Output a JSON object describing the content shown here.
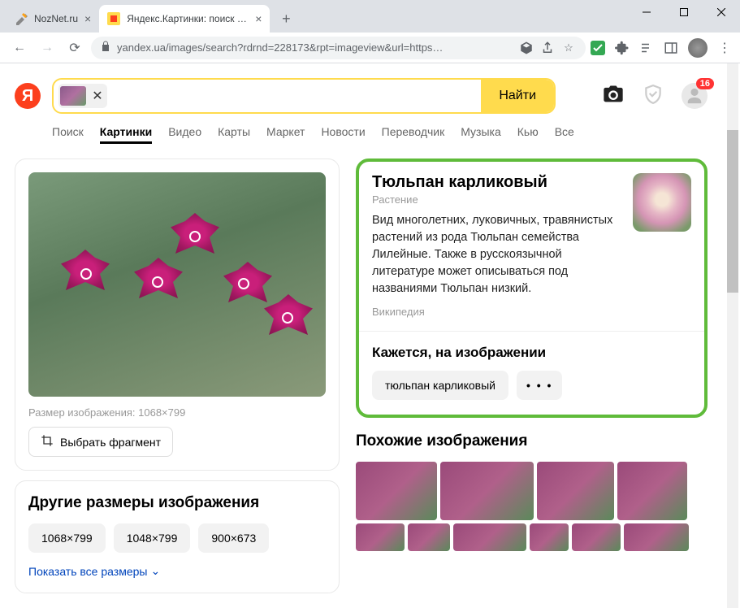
{
  "browser": {
    "tabs": [
      {
        "title": "NozNet.ru",
        "active": false
      },
      {
        "title": "Яндекс.Картинки: поиск по изоб",
        "active": true
      }
    ],
    "url": "yandex.ua/images/search?rdrnd=228173&rpt=imageview&url=https…"
  },
  "search": {
    "button": "Найти",
    "badge": "16"
  },
  "nav_tabs": [
    "Поиск",
    "Картинки",
    "Видео",
    "Карты",
    "Маркет",
    "Новости",
    "Переводчик",
    "Музыка",
    "Кью",
    "Все"
  ],
  "nav_active_index": 1,
  "left": {
    "size_label": "Размер изображения: 1068×799",
    "crop_btn": "Выбрать фрагмент",
    "other_sizes_title": "Другие размеры изображения",
    "sizes": [
      "1068×799",
      "1048×799",
      "900×673"
    ],
    "show_all": "Показать все размеры"
  },
  "right": {
    "entity_title": "Тюльпан карликовый",
    "entity_type": "Растение",
    "entity_desc": "Вид многолетних, луковичных, травянистых растений из рода Тюльпан семейства Лилейные. Также в русскоязычной литературе может описываться под названиями Тюльпан низкий.",
    "entity_source": "Википедия",
    "seems_title": "Кажется, на изображении",
    "seems_tag": "тюльпан карликовый",
    "more_dots": "• • •",
    "similar_title": "Похожие изображения"
  }
}
